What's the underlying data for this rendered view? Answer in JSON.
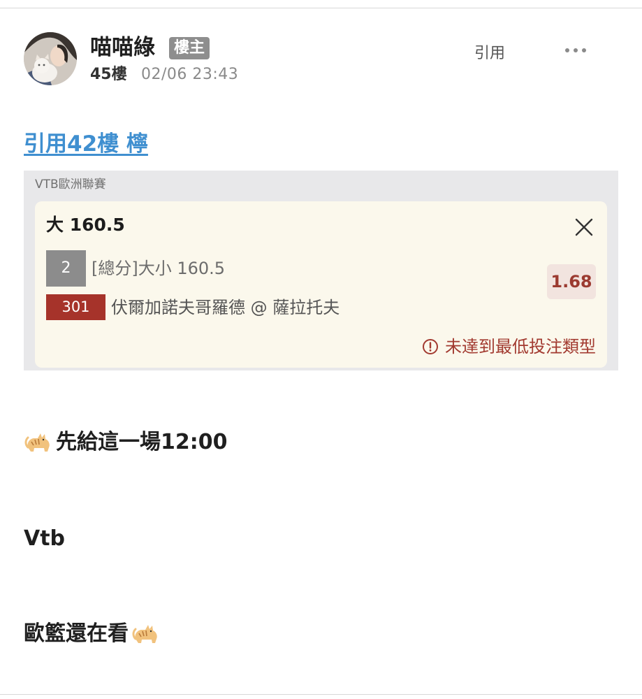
{
  "post": {
    "author": "喵喵綠",
    "badge": "樓主",
    "floor": "45樓",
    "timestamp": "02/06 23:43",
    "quote_action": "引用",
    "more_icon": "more-horizontal-icon"
  },
  "quote": {
    "link_text": "引用42樓 檸"
  },
  "bet": {
    "league": "VTB歐洲聯賽",
    "title": "大 160.5",
    "market_code": "2",
    "market": "[總分]大小 160.5",
    "match_code": "301",
    "match": "伏爾加諾夫哥羅德 @ 薩拉托夫",
    "odds": "1.68",
    "warning": "未達到最低投注類型",
    "colors": {
      "odds_text": "#9b3a30",
      "match_badge": "#a6332a",
      "warning": "#a23a30",
      "slip_background": "#fbf8ec"
    }
  },
  "content": {
    "line1": "先給這一場12:00",
    "line2": "Vtb",
    "line3": "歐籃還在看",
    "emoji_icon": "cat-emoji-icon"
  },
  "colors": {
    "link": "#3f8fd0",
    "badge": "#8e8e8e"
  }
}
